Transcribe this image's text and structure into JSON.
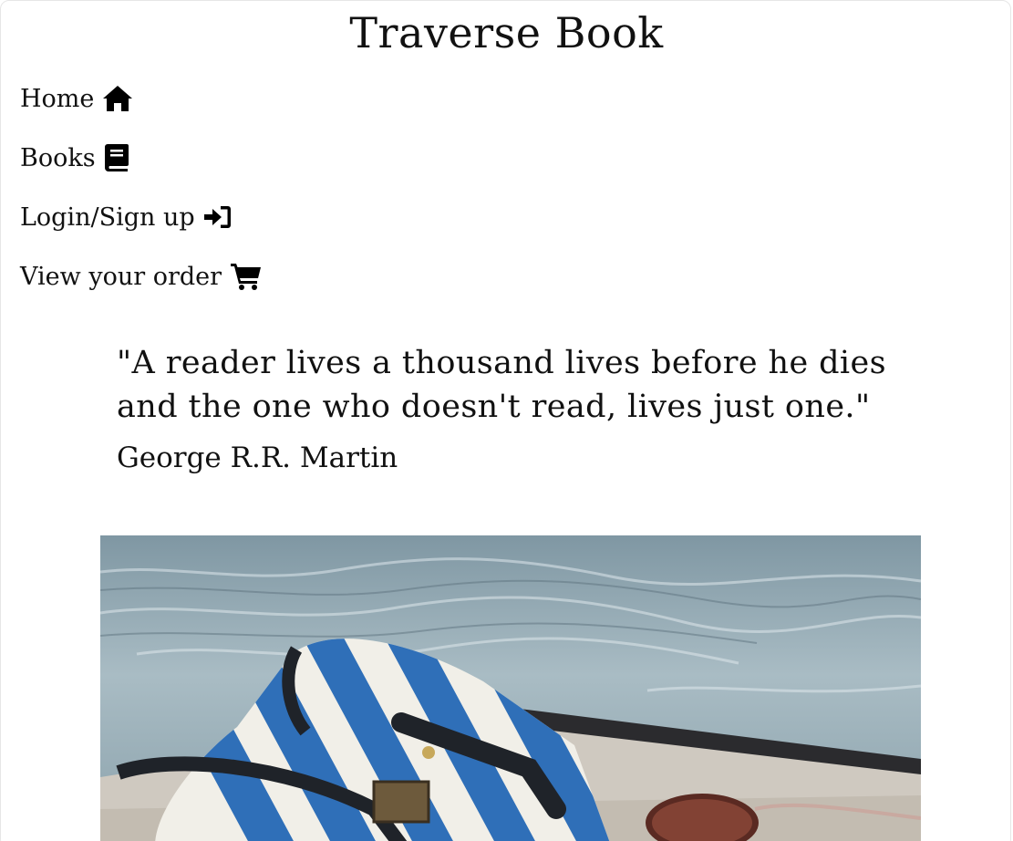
{
  "site": {
    "title": "Traverse Book"
  },
  "nav": {
    "items": [
      {
        "label": "Home",
        "icon": "home-icon"
      },
      {
        "label": "Books",
        "icon": "book-icon"
      },
      {
        "label": "Login/Sign up",
        "icon": "sign-in-icon"
      },
      {
        "label": "View your order",
        "icon": "shopping-cart-icon"
      }
    ]
  },
  "quote": {
    "text": "\"A reader lives a thousand lives before he dies and the one who doesn't read, lives just one.\"",
    "author": "George R.R. Martin"
  },
  "hero": {
    "image": "striped-bag-and-sunglasses-by-water-photo"
  },
  "colors": {
    "text": "#111111",
    "background": "#ffffff",
    "water": "#8fa6b0",
    "stripe_blue": "#2f6fb8"
  }
}
